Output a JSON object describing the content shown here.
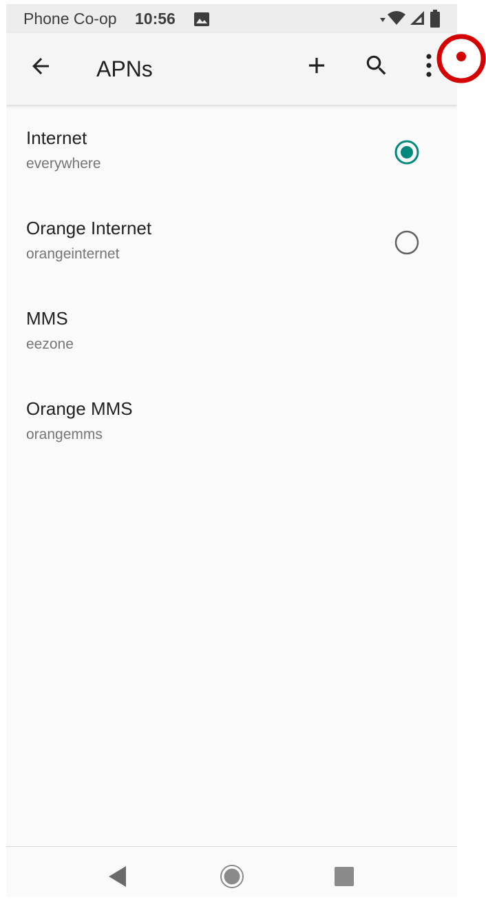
{
  "status_bar": {
    "carrier": "Phone Co-op",
    "time": "10:56",
    "icons": [
      "gallery-icon",
      "data-arrow-icon",
      "wifi-icon",
      "signal-icon",
      "battery-icon"
    ]
  },
  "app_bar": {
    "title": "APNs",
    "actions": [
      "back-arrow-icon",
      "add-icon",
      "search-icon",
      "more-vert-icon"
    ]
  },
  "apns": [
    {
      "name": "Internet",
      "apn": "everywhere",
      "selected": true
    },
    {
      "name": "Orange Internet",
      "apn": "orangeinternet",
      "selected": false
    },
    {
      "name": "MMS",
      "apn": "eezone"
    },
    {
      "name": "Orange MMS",
      "apn": "orangemms"
    }
  ],
  "nav_bar": {
    "buttons": [
      "nav-back-icon",
      "nav-home-icon",
      "nav-recents-icon"
    ]
  },
  "colors": {
    "accent": "#00897b",
    "tap_indicator": "#d50000",
    "status_bar_bg": "#ededed",
    "app_bar_bg": "#f5f5f5",
    "background": "#fafafa"
  }
}
